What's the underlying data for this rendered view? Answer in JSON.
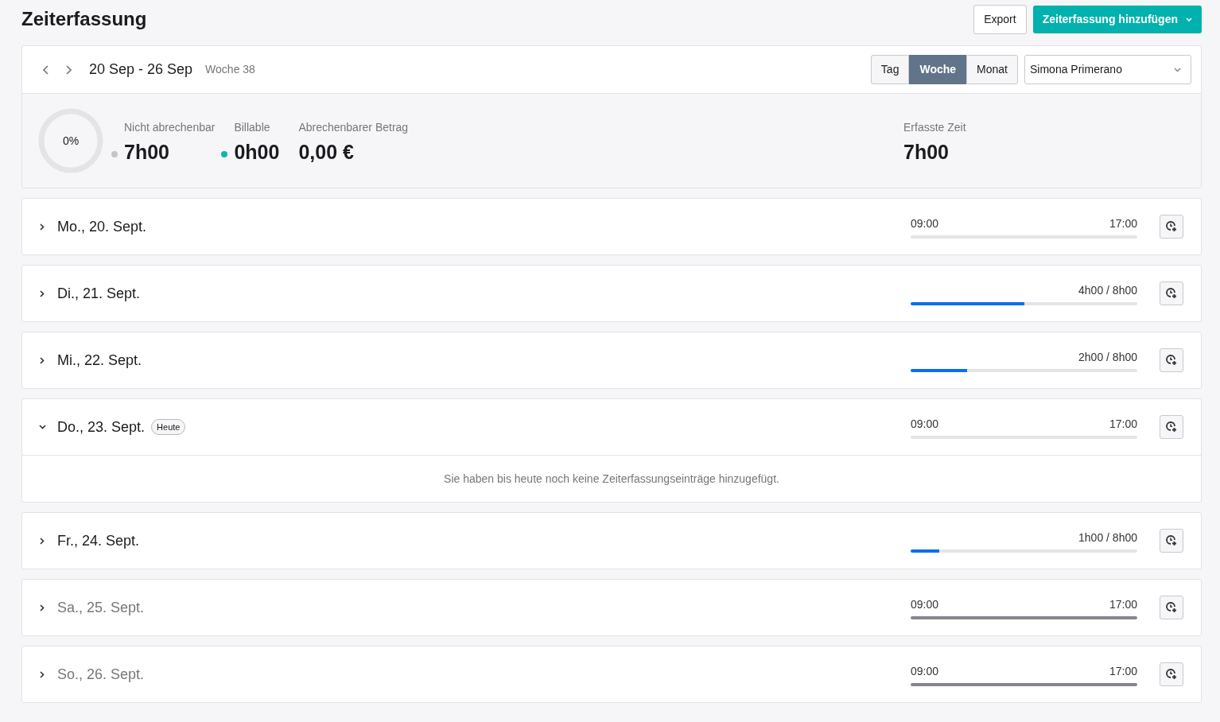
{
  "page_title": "Zeiterfassung",
  "actions": {
    "export": "Export",
    "add": "Zeiterfassung hinzufügen"
  },
  "period": {
    "range": "20 Sep - 26 Sep",
    "week": "Woche 38"
  },
  "view_tabs": [
    {
      "label": "Tag",
      "selected": false
    },
    {
      "label": "Woche",
      "selected": true
    },
    {
      "label": "Monat",
      "selected": false
    }
  ],
  "user_select": {
    "value": "Simona Primerano"
  },
  "summary": {
    "donut": {
      "label": "0%",
      "level": 0
    },
    "stats": [
      {
        "label": "Nicht abrechenbar",
        "value": "7h00",
        "color": "#c4c4c8"
      },
      {
        "label": "Billable",
        "value": "0h00",
        "color": "#12b5b0"
      },
      {
        "label": "Abrechenbarer Betrag",
        "value": "0,00 €"
      }
    ],
    "total": {
      "label": "Erfasste Zeit",
      "value": "7h00"
    }
  },
  "days": [
    {
      "label": "Mo., 20. Sept.",
      "kind": "range",
      "start": "09:00",
      "end": "17:00",
      "weekend": false,
      "expanded": false
    },
    {
      "label": "Di., 21. Sept.",
      "kind": "progress",
      "reading": "4h00 / 8h00",
      "level": 0.5,
      "weekend": false,
      "expanded": false
    },
    {
      "label": "Mi., 22. Sept.",
      "kind": "progress",
      "reading": "2h00 / 8h00",
      "level": 0.25,
      "weekend": false,
      "expanded": false
    },
    {
      "label": "Do., 23. Sept.",
      "badge": "Heute",
      "kind": "range",
      "start": "09:00",
      "end": "17:00",
      "weekend": false,
      "expanded": true,
      "empty_message": "Sie haben bis heute noch keine Zeiterfassungseinträge hinzugefügt."
    },
    {
      "label": "Fr., 24. Sept.",
      "kind": "progress",
      "reading": "1h00 / 8h00",
      "level": 0.125,
      "weekend": false,
      "expanded": false
    },
    {
      "label": "Sa., 25. Sept.",
      "kind": "range",
      "start": "09:00",
      "end": "17:00",
      "weekend": true,
      "expanded": false
    },
    {
      "label": "So., 26. Sept.",
      "kind": "range",
      "start": "09:00",
      "end": "17:00",
      "weekend": true,
      "expanded": false
    }
  ]
}
